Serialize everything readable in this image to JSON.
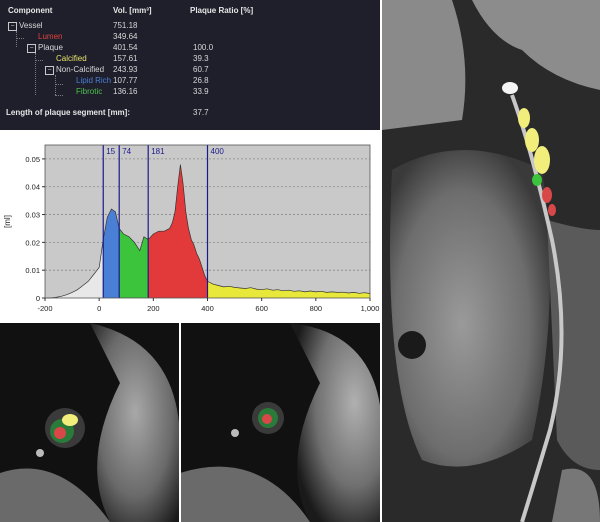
{
  "table": {
    "headers": {
      "component": "Component",
      "vol": "Vol. [mm³]",
      "ratio": "Plaque Ratio [%]"
    },
    "rows": [
      {
        "label": "Vessel",
        "vol": "751.18",
        "ratio": "",
        "color": "#d8d8d8"
      },
      {
        "label": "Lumen",
        "vol": "349.64",
        "ratio": "",
        "color": "#e0403c"
      },
      {
        "label": "Plaque",
        "vol": "401.54",
        "ratio": "100.0",
        "color": "#d8d8d8"
      },
      {
        "label": "Calcified",
        "vol": "157.61",
        "ratio": "39.3",
        "color": "#e8e36a"
      },
      {
        "label": "Non-Calcified",
        "vol": "243.93",
        "ratio": "60.7",
        "color": "#d8d8d8"
      },
      {
        "label": "Lipid Rich",
        "vol": "107.77",
        "ratio": "26.8",
        "color": "#4a7fd6"
      },
      {
        "label": "Fibrotic",
        "vol": "136.16",
        "ratio": "33.9",
        "color": "#4cc04c"
      }
    ],
    "length_label": "Length of plaque segment [mm]:",
    "length_value": "37.7"
  },
  "chart_data": {
    "type": "area",
    "ylabel": "[ml]",
    "xlim": [
      -200,
      1000
    ],
    "ylim": [
      0,
      0.055
    ],
    "x_ticks": [
      "-200",
      "0",
      "200",
      "400",
      "600",
      "800",
      "1,000"
    ],
    "y_ticks": [
      "0",
      "0.01",
      "0.02",
      "0.03",
      "0.04",
      "0.05"
    ],
    "thresholds": [
      15,
      74,
      181,
      400
    ],
    "threshold_labels": [
      "15",
      "74",
      "181",
      "400"
    ],
    "bands": [
      {
        "from": -200,
        "to": 15,
        "color": "#e8e8e8"
      },
      {
        "from": 15,
        "to": 74,
        "color": "#4a7fd6"
      },
      {
        "from": 74,
        "to": 181,
        "color": "#3cc43c"
      },
      {
        "from": 181,
        "to": 400,
        "color": "#e23a3a"
      },
      {
        "from": 400,
        "to": 1000,
        "color": "#e8e83a"
      }
    ],
    "x": [
      -200,
      -180,
      -160,
      -140,
      -120,
      -100,
      -80,
      -60,
      -40,
      -20,
      0,
      15,
      30,
      45,
      60,
      74,
      90,
      110,
      130,
      150,
      165,
      181,
      200,
      220,
      240,
      260,
      270,
      280,
      290,
      300,
      310,
      320,
      330,
      340,
      350,
      360,
      370,
      380,
      390,
      400,
      420,
      440,
      460,
      480,
      500,
      520,
      540,
      560,
      580,
      600,
      620,
      640,
      660,
      680,
      700,
      720,
      740,
      760,
      780,
      800,
      820,
      840,
      860,
      880,
      900,
      920,
      940,
      960,
      980,
      1000
    ],
    "y": [
      0,
      0,
      0.0002,
      0.0006,
      0.0012,
      0.002,
      0.003,
      0.0045,
      0.006,
      0.0085,
      0.011,
      0.021,
      0.029,
      0.032,
      0.031,
      0.025,
      0.023,
      0.022,
      0.02,
      0.017,
      0.022,
      0.021,
      0.023,
      0.024,
      0.024,
      0.025,
      0.027,
      0.031,
      0.04,
      0.048,
      0.041,
      0.031,
      0.025,
      0.021,
      0.019,
      0.016,
      0.014,
      0.011,
      0.008,
      0.006,
      0.005,
      0.0045,
      0.004,
      0.0042,
      0.0038,
      0.0036,
      0.0034,
      0.0037,
      0.0032,
      0.003,
      0.0033,
      0.0028,
      0.003,
      0.0026,
      0.0028,
      0.0024,
      0.0026,
      0.0022,
      0.0025,
      0.0022,
      0.0024,
      0.002,
      0.0022,
      0.002,
      0.0021,
      0.0018,
      0.002,
      0.0017,
      0.0019,
      0.0016
    ]
  },
  "colors": {
    "lumen": "#e23a3a",
    "calcified": "#f0ea70",
    "lipid": "#4a7fd6",
    "fibrotic": "#3cc43c",
    "threshold_line": "#1a1a8a"
  }
}
